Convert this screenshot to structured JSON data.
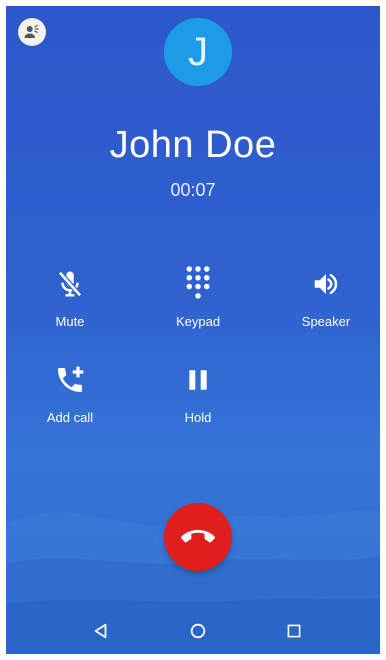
{
  "contact": {
    "initial": "J",
    "name": "John Doe"
  },
  "call": {
    "duration": "00:07"
  },
  "controls": {
    "mute_label": "Mute",
    "keypad_label": "Keypad",
    "speaker_label": "Speaker",
    "add_call_label": "Add call",
    "hold_label": "Hold"
  },
  "icons": {
    "top_left": "voice-contact-icon",
    "mute": "mic-off-icon",
    "keypad": "dialpad-icon",
    "speaker": "volume-up-icon",
    "add_call": "add-call-icon",
    "hold": "pause-icon",
    "end_call": "call-end-icon",
    "nav_back": "back-triangle-icon",
    "nav_home": "home-circle-icon",
    "nav_recents": "recents-square-icon"
  },
  "colors": {
    "background": "#2f62cf",
    "avatar": "#1e9be8",
    "end_call": "#e01e1e"
  }
}
